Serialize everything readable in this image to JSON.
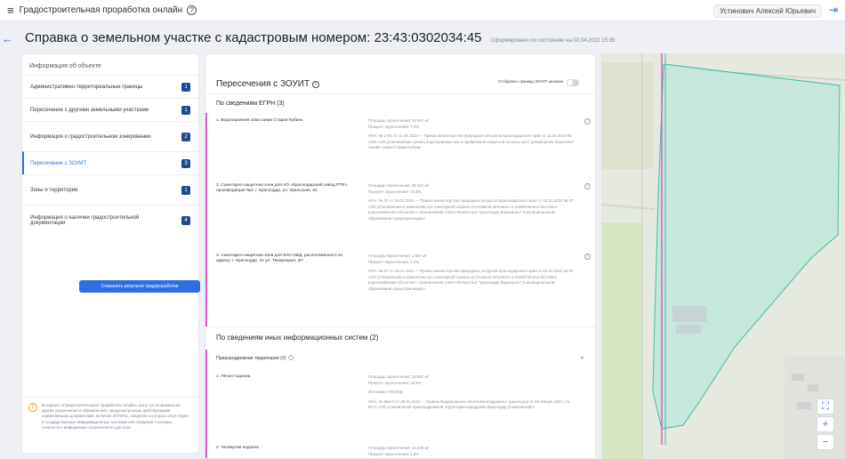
{
  "topbar": {
    "app_title": "Градостроительная проработка онлайн",
    "help_symbol": "?",
    "user_name": "Устинович Алексей Юрьевич"
  },
  "title": {
    "heading": "Справка о земельном участке с кадастровым номером: 23:43:0302034:45",
    "formed_at": "Сформировано по состоянию на 02.04.2022 15:35"
  },
  "sidebar": {
    "header": "Информация об объекте",
    "items": [
      {
        "label": "Административно-территориальные границы",
        "count": "1"
      },
      {
        "label": "Пересечение с другими земельными участками",
        "count": "1"
      },
      {
        "label": "Информация о градостроительном зонировании",
        "count": "2"
      },
      {
        "label": "Пересечение с ЗОУИТ",
        "count": "3"
      },
      {
        "label": "Зоны и территории",
        "count": "1"
      },
      {
        "label": "Информация о наличии градостроительной документации",
        "count": "4"
      }
    ],
    "save_button": "Сохранить результат градпроработки",
    "notice": "В сервисе «Градостроительная проработка онлайн» могут не отображаться другие ограничения и обременения, предусмотренные действующими нормативными документами, включая ЗОУИТы, сведения о которых отсутствуют в государственных информационных системах или сведения о которых относятся к информации ограниченного доступа."
  },
  "main": {
    "title": "Пересечения с ЗОУИТ",
    "toggle_label": "Отобразить границы ЗОУИТ целиком",
    "egrn_section": "По сведениям ЕГРН (3)",
    "egrn_items": [
      {
        "name": "1. Водоохранная зона озера Старая Кубань",
        "area": "Площадь пересечения: 15 857 м²",
        "percent": "Процент пересечения: 7,3%",
        "doc": "НПА: № 1791 от 11.08.2010 — Приказ министерства природных ресурсов Краснодарского края от 11.08.2010 № 1791 «Об установлении границ водоохранных зон и прибрежной защитной полосы, мест размещения береговой линии» озера Старая Кубань"
      },
      {
        "name": "2. Санитарно-защитная зона для АО «Краснодарский завод РТИ», производящая №2, г. Краснодар, ул. Уральская, 81",
        "area": "Площадь пересечения: 25 857 м²",
        "percent": "Процент пересечения: 10,9%",
        "doc": "НПА: № 37 от 18.01.2022 — Приказ министерства природных ресурсов Краснодарского края от 18.01.2022 № 37 «Об установлении и изменении зон санитарной охраны источников питьевого и хозяйственно-бытового водоснабжения объектов с ограниченной ответственностью \"Краснодар Водоканал\" в муниципальном образовании город Краснодар»"
      },
      {
        "name": "3. Санитарно-защитная зона для ЗАО ОБД, расположенного по адресу: г. Краснодар, по ул. Тихорецкая, 2П",
        "area": "Площадь пересечения: 1 897 м²",
        "percent": "Процент пересечения: 2,4%",
        "doc": "НПА: № 37 от 18.01.2022 — Приказ министерства природных ресурсов Краснодарского края от 18.01.2022 № 37 «Об установлении и изменении зон санитарной охраны источников питьевого и хозяйственно-бытового водоснабжения объектов с ограниченной ответственностью \"Краснодар Водоканал\" в муниципальном образовании город Краснодар»"
      }
    ],
    "other_section": "По сведениям иных информационных систем (2)",
    "other_group": "Приаэродромная территория (2)",
    "other_items": [
      {
        "name": "1. Пятая подзона",
        "area": "Площадь пересечения: 25 857 м²",
        "percent": "Процент пересечения: 10,9%",
        "source": "Источник: ГИСОГД",
        "doc": "НПА: № 950-П от 29.01.2021 — Приказ Федерального агентства воздушного транспорта от 29 января 2021 г. N 90-П «Об установлении приаэродромной территории аэродрома Краснодар (Пашковский)»"
      },
      {
        "name": "2. Четвертая подзона",
        "area": "Площадь пересечения: 44 445 м²",
        "percent": "Процент пересечения: 1,8%"
      }
    ]
  },
  "map": {
    "controls": [
      "⛶",
      "+",
      "−"
    ],
    "colors": {
      "parcel_fill": "#b6e8da",
      "parcel_stroke": "#3fbf9f",
      "zone_stroke": "#e35ac8",
      "field": "#d6e6c4"
    }
  },
  "colors": {
    "accent": "#2f6fe0",
    "badge": "#1e4a92",
    "zone_accent": "#e35ac8"
  }
}
